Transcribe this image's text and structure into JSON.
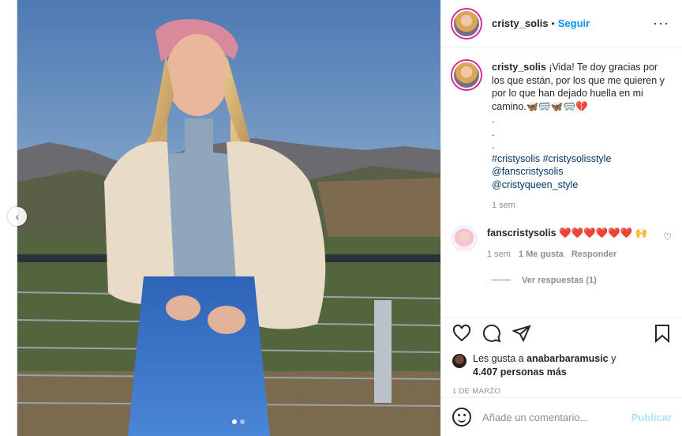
{
  "post": {
    "username": "cristy_solis",
    "follow_label": "Seguir",
    "separator": "•",
    "more": "···",
    "caption": {
      "username": "cristy_solis",
      "text": "¡Vida! Te doy gracias por los que están, por los que me quieren y por lo que han dejado huella en mi camino.🦋🥽🦋🥽💔",
      "dots": [
        ".",
        ".",
        "."
      ],
      "hashtags": [
        "#cristysolis #cristysolisstyle"
      ],
      "mentions": [
        "@fanscristysolis",
        "@cristyqueen_style"
      ],
      "time": "1 sem"
    },
    "comments": [
      {
        "username": "fanscristysolis",
        "text": "❤️❤️❤️❤️❤️❤️ 🙌",
        "time": "1 sem",
        "likes": "1 Me gusta",
        "reply_label": "Responder",
        "view_replies": "Ver respuestas (1)"
      }
    ],
    "likes": {
      "prefix": "Les gusta a ",
      "user": "anabarbaramusic",
      "middle": " y",
      "count": "4.407 personas más"
    },
    "date": "1 DE MARZO",
    "add_comment": {
      "placeholder": "Añade un comentario...",
      "publish_label": "Publicar"
    }
  },
  "photo": {
    "carousel_dots": 2,
    "active_dot": 0
  },
  "nav": {
    "prev_arrow": "‹"
  },
  "colors": {
    "link": "#0095f6",
    "hashtag": "#00376b",
    "muted": "#8e8e8e"
  },
  "icons": [
    "heart-icon",
    "comment-icon",
    "share-icon",
    "bookmark-icon",
    "emoji-icon"
  ]
}
